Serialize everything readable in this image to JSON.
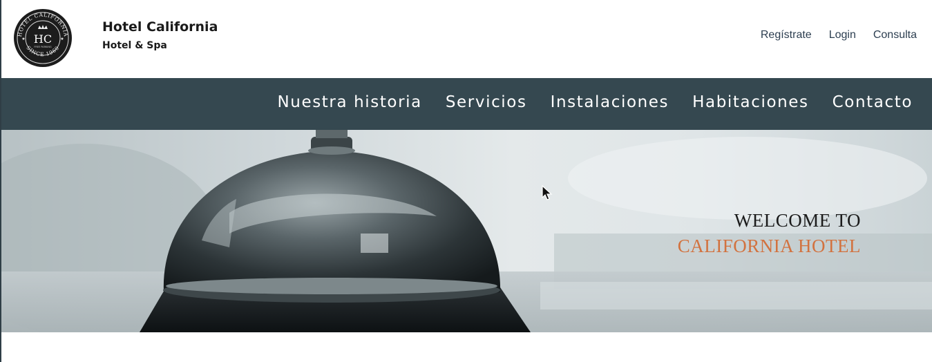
{
  "header": {
    "logo": {
      "icon": "hotel-california-seal",
      "ring_text_top": "HOTEL CALIFORNIA",
      "monogram": "HC",
      "small_text": "FREE PARKING",
      "ring_text_bottom": "SINCE 1960"
    },
    "title": "Hotel California",
    "subtitle": "Hotel & Spa",
    "links": [
      "Regístrate",
      "Login",
      "Consulta"
    ]
  },
  "nav": {
    "items": [
      "Nuestra historia",
      "Servicios",
      "Instalaciones",
      "Habitaciones",
      "Contacto"
    ]
  },
  "hero": {
    "image": "service-bell-photo",
    "welcome_line1": "WELCOME TO",
    "welcome_line2": "CALIFORNIA HOTEL",
    "accent_color": "#d2723f"
  },
  "colors": {
    "navbar": "#354850",
    "text_dark": "#1a1a1a",
    "link": "#2c3e50"
  }
}
